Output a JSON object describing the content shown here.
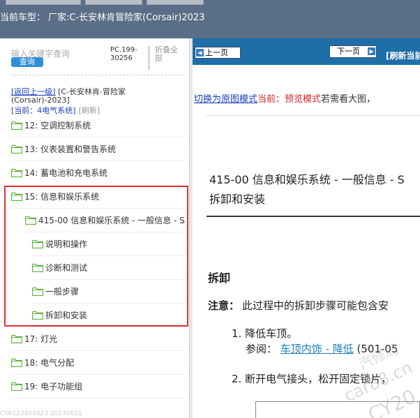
{
  "header": {
    "vehicle_label": "当前车型：",
    "vehicle_value": "厂家:C-长安林肯冒险家(Corsair)2023"
  },
  "sidebar": {
    "search_placeholder": "输入关键字查询",
    "search_button": "查询",
    "pc_code": "PC.199-30256",
    "collapse_all": "折叠全部",
    "back_link": "[返回上一级]",
    "back_text": "[C-长安林肯-冒险家(Corsair)-2023]",
    "current_label": "[当前：",
    "current_value": "4电气系统]",
    "refresh_link": "[刷新]",
    "items": [
      {
        "label": "12: 空调控制系统"
      },
      {
        "label": "13: 仪表装置和警告系统"
      },
      {
        "label": "14: 蓄电池和充电系统"
      },
      {
        "label": "15: 信息和娱乐系统"
      },
      {
        "label": "415-00 信息和娱乐系统 - 一般信息 - S"
      },
      {
        "label": "说明和操作"
      },
      {
        "label": "诊断和测试"
      },
      {
        "label": "一般步骤"
      },
      {
        "label": "拆卸和安装"
      },
      {
        "label": "17: 灯光"
      },
      {
        "label": "18: 电气分配"
      },
      {
        "label": "19: 电子功能组"
      }
    ],
    "footer_id": "CY6123404923 20230621"
  },
  "content": {
    "prev_button": "上一页",
    "next_button": "下一页",
    "refresh_page": "[刷新当前",
    "switch_link": "切换为原图模式",
    "current_mode": "当前：预览模式",
    "mode_rest": "若需看大图，",
    "doc_title_line1": "415-00 信息和娱乐系统 - 一般信息 - S",
    "doc_title_line2": "拆卸和安装",
    "section_heading": "拆卸",
    "note_label": "注意：",
    "note_text": "此过程中的拆卸步骤可能包含安",
    "step1": "1. 降低车顶。",
    "ref_label": "参阅：",
    "ref_link": "车顶内饰 - 降低",
    "ref_code": "(501-05",
    "step2": "2. 断开电气接头，松开固定锁片，"
  },
  "watermark": {
    "text1": "汽修局",
    "text2": "car88.cn",
    "text3": "CY20"
  },
  "colors": {
    "topbar": "#5a6e87",
    "navbar": "#1e6fa8",
    "link_blue": "#1a3fbf",
    "preview_red": "#d42424",
    "highlight_border": "#e03030",
    "folder_green": "#5bb33a"
  }
}
